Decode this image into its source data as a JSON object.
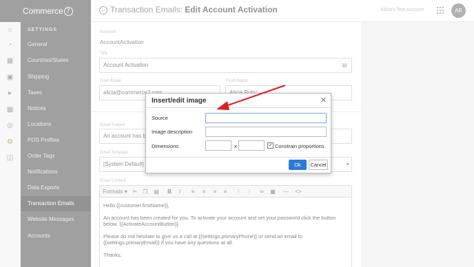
{
  "brand": {
    "name": "Commerce",
    "mark": "7"
  },
  "header": {
    "back_icon": "circle-arrow-left-icon",
    "title_prefix": "Transaction Emails:",
    "title_main": "Edit Account Activation",
    "account": "Alicia's Test Account",
    "avatar": "AR"
  },
  "rail_icons": [
    "home-icon",
    "palette-icon",
    "store-icon",
    "bag-icon",
    "megaphone-icon",
    "chart-icon",
    "globe-icon",
    "gear-icon",
    "puzzle-icon"
  ],
  "sidebar": {
    "heading": "SETTINGS",
    "items": [
      {
        "label": "General"
      },
      {
        "label": "Countries/States"
      },
      {
        "label": "Shipping"
      },
      {
        "label": "Taxes"
      },
      {
        "label": "Notices"
      },
      {
        "label": "Locations"
      },
      {
        "label": "POS Profiles"
      },
      {
        "label": "Order Tags"
      },
      {
        "label": "Notifications"
      },
      {
        "label": "Data Exports"
      },
      {
        "label": "Transaction Emails",
        "active": true
      },
      {
        "label": "Website Messages"
      },
      {
        "label": "Accounts"
      }
    ]
  },
  "form": {
    "keyword_label": "Keyword",
    "keyword_value": "AccountActivation",
    "title_label": "Title",
    "title_value": "Account Activation",
    "from_email_label": "From Email",
    "from_email_value": "alicia@commerce7.com",
    "from_name_label": "From Name",
    "from_name_value": "Alicia Ruby",
    "subject_label": "Email Subject",
    "subject_value": "An account has been created for you",
    "template_label": "Email Template",
    "template_value": "[System Default]",
    "content_label": "Email Content"
  },
  "toolbar": {
    "formats": "Formats"
  },
  "editor": {
    "lines": [
      "Hello {{customer.firstName}},",
      "An account has been created for you. To activate your account and set your password click the button below. {{ActivateAccountButton}}",
      "Please do not hesitate to give us a call at {{settings.primaryPhone}} or send an email to {{settings.primaryEmail}} if you have any questions at all.",
      "Thanks,"
    ]
  },
  "dialog": {
    "title": "Insert/edit image",
    "source_label": "Source",
    "description_label": "Image description",
    "dimensions_label": "Dimensions",
    "x_label": "x",
    "constrain_label": "Constrain proportions",
    "constrain_checked": true,
    "ok_label": "Ok",
    "cancel_label": "Cancel"
  },
  "colors": {
    "accent": "#2b7bd6",
    "sidebar": "#6d6d6d",
    "arrow": "#e02020"
  }
}
